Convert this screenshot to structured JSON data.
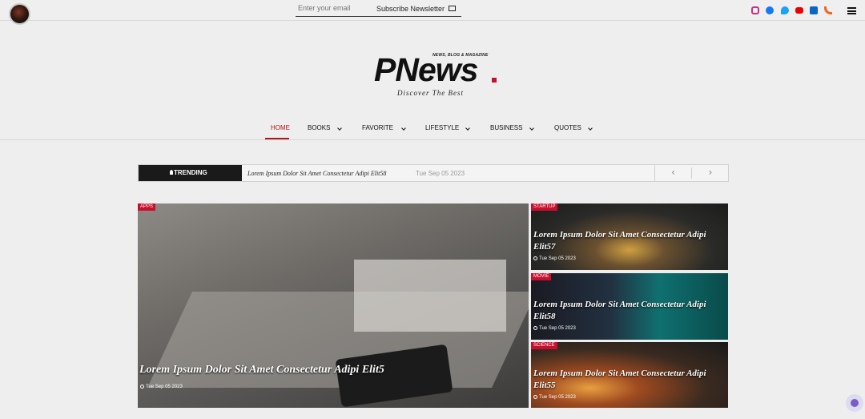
{
  "topbar": {
    "newsletter_placeholder": "Enter your email",
    "subscribe_label": "Subscribe Newsletter",
    "social": [
      "instagram-icon",
      "facebook-icon",
      "twitter-icon",
      "youtube-icon",
      "linkedin-icon",
      "rss-icon"
    ]
  },
  "brand": {
    "tagline": "NEWS, BLOG & MAGAZINE",
    "logo": "PNews",
    "subtitle": "Discover The Best",
    "accent": "#c8102e"
  },
  "nav": {
    "items": [
      {
        "label": "HOME"
      },
      {
        "label": "BOOKS"
      },
      {
        "label": "FAVORITE"
      },
      {
        "label": "LIFESTYLE"
      },
      {
        "label": "BUSINESS"
      },
      {
        "label": "QUOTES"
      }
    ],
    "active_color": "#b5121b"
  },
  "trending": {
    "label": "TRENDING",
    "headline": "Lorem Ipsum Dolor Sit Amet Consectetur Adipi Elit58",
    "date": "Tue Sep 05 2023",
    "prev": "‹",
    "next": "›"
  },
  "featured": {
    "category": "APPS",
    "title": "Lorem Ipsum Dolor Sit Amet Consectetur Adipi Elit5",
    "date": "Tue Sep 05 2023"
  },
  "side_posts": [
    {
      "category": "STARTUP",
      "title": "Lorem Ipsum Dolor Sit Amet Consectetur Adipi Elit57",
      "date": "Tue Sep 05 2023"
    },
    {
      "category": "MOVIE",
      "title": "Lorem Ipsum Dolor Sit Amet Consectetur Adipi Elit58",
      "date": "Tue Sep 05 2023"
    },
    {
      "category": "SCIENCE",
      "title": "Lorem Ipsum Dolor Sit Amet Consectetur Adipi Elit55",
      "date": "Tue Sep 05 2023"
    }
  ]
}
